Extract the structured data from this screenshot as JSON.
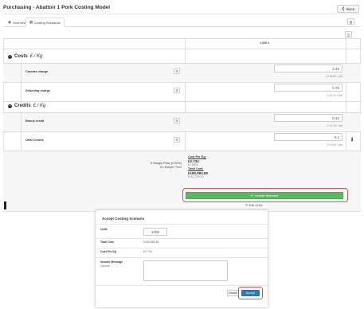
{
  "page": {
    "title": "Purchasing - Abattoir 1 Pork Costing Model",
    "back_label": "Back"
  },
  "tabs": [
    {
      "label": "Overview",
      "icon": "globe-icon"
    },
    {
      "label": "Costing Scenarios",
      "icon": "table-icon"
    }
  ],
  "toolbar": {
    "chart_icon": "chart-icon",
    "doc_icon": "document-icon"
  },
  "table": {
    "column_header": "1,000 £",
    "sections": {
      "costs": {
        "label": "Costs",
        "unit": "£ / Kg"
      },
      "credits": {
        "label": "Credits",
        "unit": "£ / Kg"
      }
    },
    "rows": {
      "carcass": {
        "label": "Carcass charge",
        "value": "2.45",
        "per_unit": "£ 166.60 / Unit"
      },
      "deboning": {
        "label": "Deboning charge",
        "value": "0.75",
        "per_unit": "£ 51.00 / Unit"
      },
      "bonus": {
        "label": "Bonus credit",
        "value": "0.32",
        "per_unit": "£ 21.76 / Unit"
      },
      "offal": {
        "label": "Offal Credits",
        "value": "0.2",
        "per_unit": "£ 13.60 / Unit"
      }
    },
    "summary": {
      "margin_line1": "£ Margin Price (2.00%)",
      "margin_line2": "Ex-Margin Price",
      "cost_per_kg_label": "Cost Per Kg:",
      "cost_per_kg_value": "£2.734",
      "cost_per_kg_ex": "£2.6806",
      "total_cost_label": "Total Cost:",
      "total_cost_value": "£185,884.80",
      "total_cost_ex": "£182,240.00",
      "accept_label": "Accept Scenario",
      "edit_units_label": "Edit Units"
    }
  },
  "modal": {
    "title": "Accept Costing Scenario",
    "units_label": "Units",
    "units_value": "1000",
    "total_cost_label": "Total Cost",
    "total_cost_value": "£185,884.80",
    "cost_per_kg_label": "Cost Per Kg",
    "cost_per_kg_value": "£2.734",
    "include_message_label": "Include Message",
    "include_message_sub": "Optional",
    "message_value": "",
    "cancel_label": "Cancel",
    "accept_label": "Accept"
  },
  "colors": {
    "accept_green": "#5cb85c",
    "primary_blue": "#337ab7",
    "highlight_red": "#d9534f"
  }
}
